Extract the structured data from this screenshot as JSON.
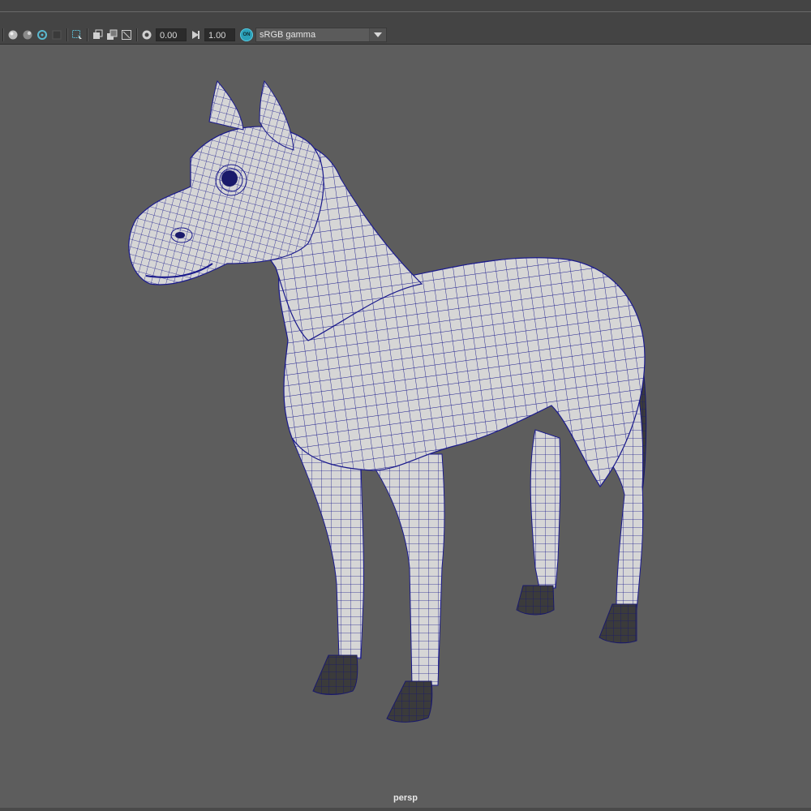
{
  "toolbar": {
    "exposure_value": "0.00",
    "gamma_value": "1.00",
    "color_management_badge": "ON",
    "color_space": "sRGB gamma",
    "icons": [
      "shaded-sphere-icon",
      "textured-sphere-icon",
      "isolate-select-icon",
      "xray-icon",
      "select-camera-icon",
      "grid-toggle-icon",
      "image-plane-icon",
      "resolution-gate-icon",
      "exposure-icon",
      "gamma-icon",
      "color-management-icon",
      "dropdown-arrow-icon"
    ]
  },
  "viewport": {
    "camera_label": "persp",
    "background_color": "#5d5d5d",
    "wireframe_color": "#1a1a8c",
    "mesh_color": "#d6d6d6",
    "hoof_color": "#3b3b3b",
    "object": "horse-mesh-wireframe-on-shaded"
  }
}
